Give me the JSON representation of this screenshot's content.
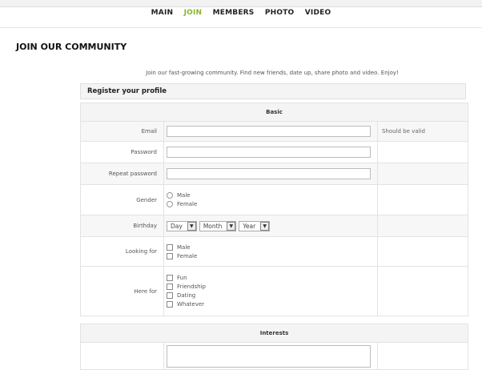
{
  "nav": {
    "items": [
      {
        "label": "MAIN"
      },
      {
        "label": "JOIN"
      },
      {
        "label": "MEMBERS"
      },
      {
        "label": "PHOTO"
      },
      {
        "label": "VIDEO"
      }
    ],
    "active": "JOIN"
  },
  "page": {
    "title": "JOIN OUR COMMUNITY",
    "intro": "Join our fast-growing community. Find new friends, date up, share photo and video. Enjoy!"
  },
  "form": {
    "box_title": "Register your profile",
    "sections": {
      "basic": "Basic",
      "interests": "Interests"
    },
    "email": {
      "label": "Email",
      "note": "Should be valid",
      "value": ""
    },
    "password": {
      "label": "Password",
      "value": ""
    },
    "repeat_password": {
      "label": "Repeat password",
      "value": ""
    },
    "gender": {
      "label": "Gender",
      "options": [
        "Male",
        "Female"
      ]
    },
    "birthday": {
      "label": "Birthday",
      "day": "Day",
      "month": "Month",
      "year": "Year"
    },
    "looking_for": {
      "label": "Looking for",
      "options": [
        "Male",
        "Female"
      ]
    },
    "here_for": {
      "label": "Here for",
      "options": [
        "Fun",
        "Friendship",
        "Dating",
        "Whatever"
      ]
    }
  },
  "colors": {
    "accent": "#8bb52a",
    "section_bg": "#f4f4f4",
    "border": "#e3e3e3"
  },
  "icons": {
    "select_arrow": "triangle-down-icon"
  }
}
